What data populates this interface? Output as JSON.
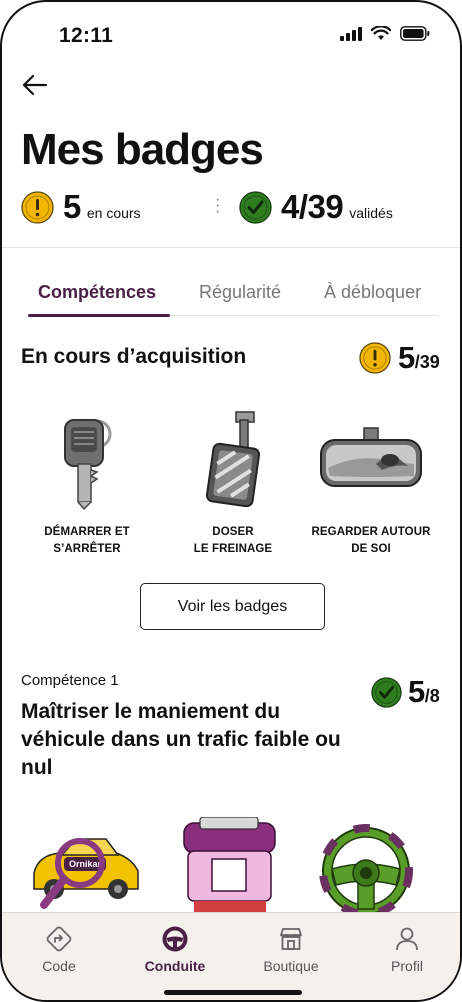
{
  "status_bar": {
    "time": "12:11"
  },
  "header": {
    "title": "Mes badges"
  },
  "summary": {
    "in_progress_count": "5",
    "in_progress_label": "en cours",
    "validated_count": "4/39",
    "validated_label": "validés"
  },
  "tabs": [
    {
      "label": "Compétences",
      "active": true
    },
    {
      "label": "Régularité",
      "active": false
    },
    {
      "label": "À débloquer",
      "active": false
    }
  ],
  "acquisition": {
    "title": "En cours d’acquisition",
    "count": "5",
    "total": "/39",
    "badges": [
      {
        "icon": "car-key-icon",
        "label": "DÉMARRER ET\nS’ARRÊTER"
      },
      {
        "icon": "brake-pedal-icon",
        "label": "DOSER\nLE FREINAGE"
      },
      {
        "icon": "rearview-mirror-icon",
        "label": "REGARDER AUTOUR\nDE SOI"
      }
    ],
    "button_label": "Voir les badges"
  },
  "competence": {
    "label": "Compétence 1",
    "title": "Maîtriser le maniement du véhicule dans un trafic faible ou nul",
    "count": "5",
    "total": "/8",
    "illustrations": [
      "ornikar-car-magnifier-icon",
      "seatbelt-icon",
      "steering-wheel-icon"
    ],
    "car_brand": "Ornikar"
  },
  "bottom_nav": [
    {
      "icon": "code-icon",
      "label": "Code",
      "active": false
    },
    {
      "icon": "steering-wheel-icon",
      "label": "Conduite",
      "active": true
    },
    {
      "icon": "shop-icon",
      "label": "Boutique",
      "active": false
    },
    {
      "icon": "profile-icon",
      "label": "Profil",
      "active": false
    }
  ],
  "colors": {
    "accent": "#4a2045",
    "pending_yellow": "#f2b705",
    "validated_green": "#2f7d20",
    "nav_background": "#f4f1ec"
  }
}
